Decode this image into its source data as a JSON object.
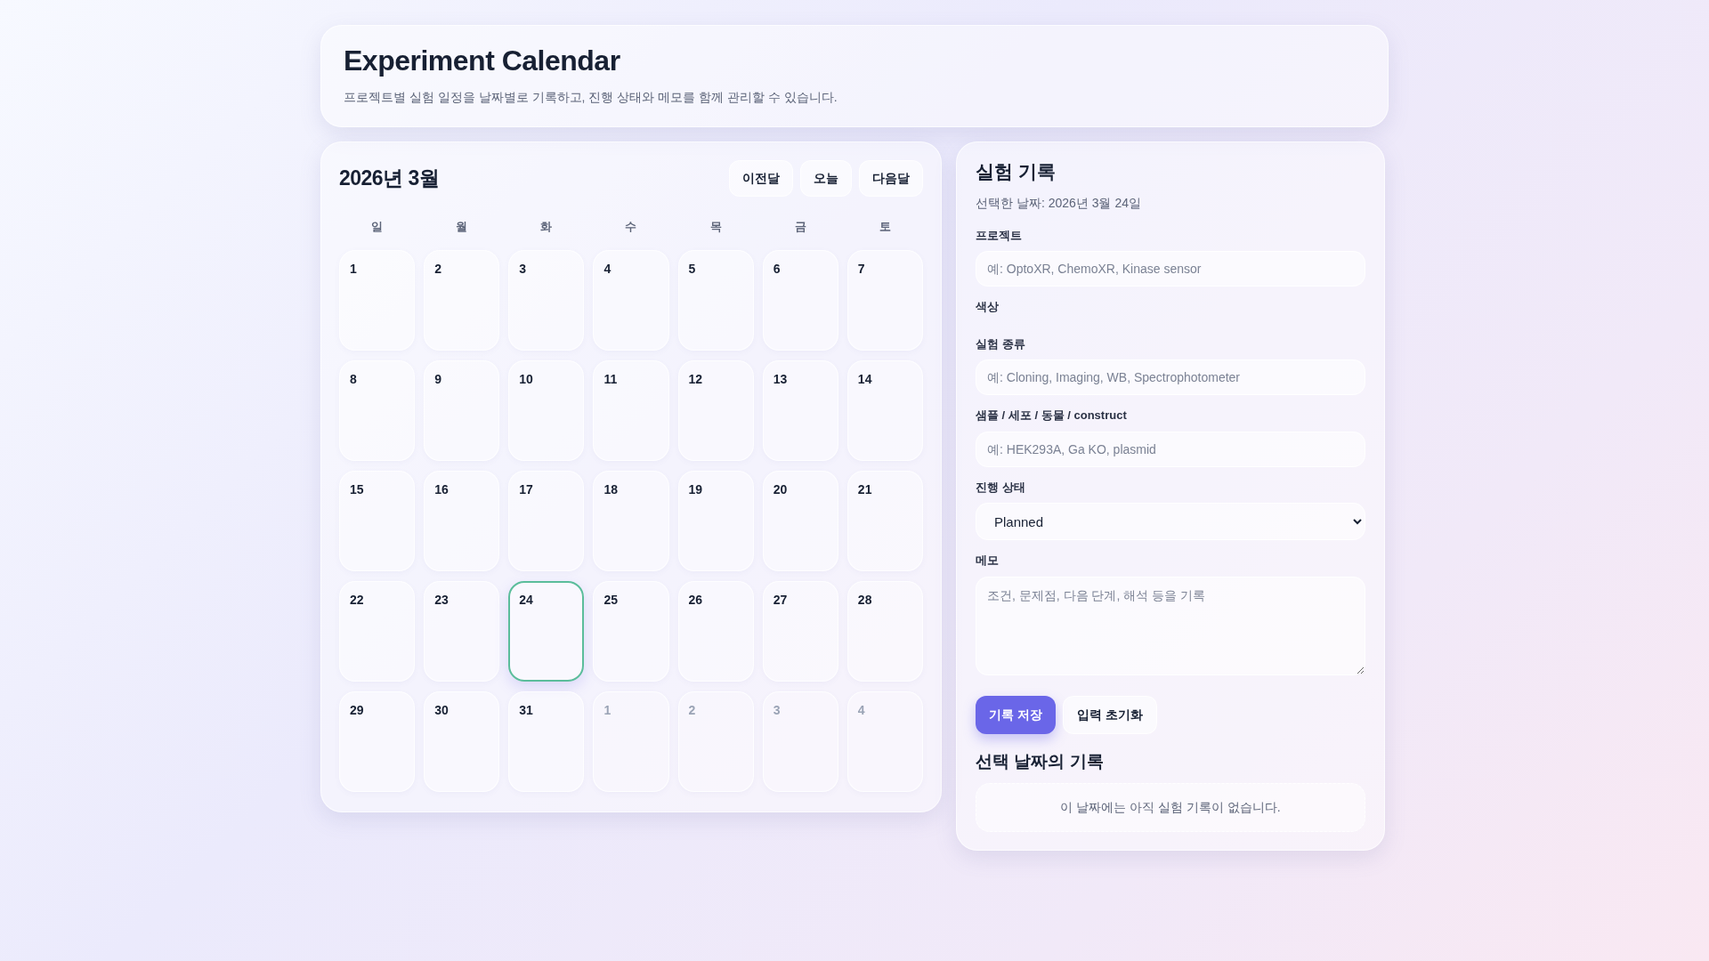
{
  "header": {
    "title": "Experiment Calendar",
    "subtitle": "프로젝트별 실험 일정을 날짜별로 기록하고, 진행 상태와 메모를 함께 관리할 수 있습니다."
  },
  "calendar": {
    "month_title": "2026년 3월",
    "nav_buttons": [
      "이전달",
      "오늘",
      "다음달"
    ],
    "weekdays": [
      "일",
      "월",
      "화",
      "수",
      "목",
      "금",
      "토"
    ],
    "days": [
      {
        "day": "1",
        "muted": false,
        "selected": false
      },
      {
        "day": "2",
        "muted": false,
        "selected": false
      },
      {
        "day": "3",
        "muted": false,
        "selected": false
      },
      {
        "day": "4",
        "muted": false,
        "selected": false
      },
      {
        "day": "5",
        "muted": false,
        "selected": false
      },
      {
        "day": "6",
        "muted": false,
        "selected": false
      },
      {
        "day": "7",
        "muted": false,
        "selected": false
      },
      {
        "day": "8",
        "muted": false,
        "selected": false
      },
      {
        "day": "9",
        "muted": false,
        "selected": false
      },
      {
        "day": "10",
        "muted": false,
        "selected": false
      },
      {
        "day": "11",
        "muted": false,
        "selected": false
      },
      {
        "day": "12",
        "muted": false,
        "selected": false
      },
      {
        "day": "13",
        "muted": false,
        "selected": false
      },
      {
        "day": "14",
        "muted": false,
        "selected": false
      },
      {
        "day": "15",
        "muted": false,
        "selected": false
      },
      {
        "day": "16",
        "muted": false,
        "selected": false
      },
      {
        "day": "17",
        "muted": false,
        "selected": false
      },
      {
        "day": "18",
        "muted": false,
        "selected": false
      },
      {
        "day": "19",
        "muted": false,
        "selected": false
      },
      {
        "day": "20",
        "muted": false,
        "selected": false
      },
      {
        "day": "21",
        "muted": false,
        "selected": false
      },
      {
        "day": "22",
        "muted": false,
        "selected": false
      },
      {
        "day": "23",
        "muted": false,
        "selected": false
      },
      {
        "day": "24",
        "muted": false,
        "selected": true
      },
      {
        "day": "25",
        "muted": false,
        "selected": false
      },
      {
        "day": "26",
        "muted": false,
        "selected": false
      },
      {
        "day": "27",
        "muted": false,
        "selected": false
      },
      {
        "day": "28",
        "muted": false,
        "selected": false
      },
      {
        "day": "29",
        "muted": false,
        "selected": false
      },
      {
        "day": "30",
        "muted": false,
        "selected": false
      },
      {
        "day": "31",
        "muted": false,
        "selected": false
      },
      {
        "day": "1",
        "muted": true,
        "selected": false
      },
      {
        "day": "2",
        "muted": true,
        "selected": false
      },
      {
        "day": "3",
        "muted": true,
        "selected": false
      },
      {
        "day": "4",
        "muted": true,
        "selected": false
      }
    ]
  },
  "record_panel": {
    "title": "실험 기록",
    "selected_date": "선택한 날짜: 2026년 3월 24일",
    "fields": [
      {
        "kind": "text",
        "label": "프로젝트",
        "placeholder": "예: OptoXR, ChemoXR, Kinase sensor"
      },
      {
        "kind": "color",
        "label": "색상"
      },
      {
        "kind": "text",
        "label": "실험 종류",
        "placeholder": "예: Cloning, Imaging, WB, Spectrophotometer"
      },
      {
        "kind": "text",
        "label": "샘플 / 세포 / 동물 / construct",
        "placeholder": "예: HEK293A, Ga KO, plasmid"
      },
      {
        "kind": "select",
        "label": "진행 상태",
        "value": "Planned"
      },
      {
        "kind": "textarea",
        "label": "메모",
        "placeholder": "조건, 문제점, 다음 단계, 해석 등을 기록"
      }
    ],
    "buttons": [
      {
        "kind": "primary",
        "label": "기록 저장"
      },
      {
        "kind": "secondary",
        "label": "입력 초기화"
      }
    ],
    "records_title": "선택 날짜의 기록",
    "empty_message": "이 날짜에는 아직 실험 기록이 없습니다."
  }
}
